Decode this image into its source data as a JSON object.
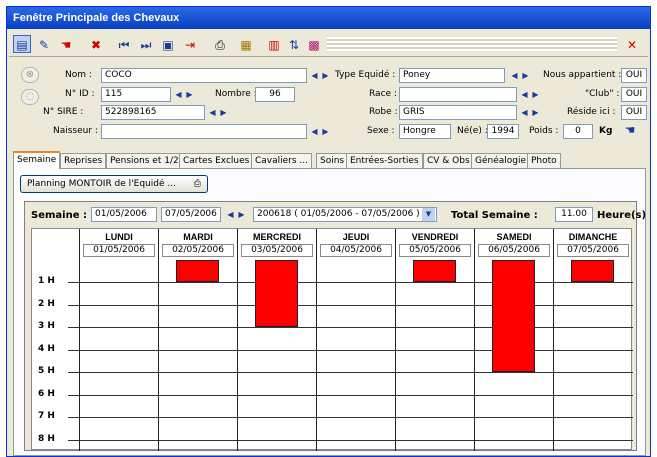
{
  "window": {
    "title": "Fenêtre Principale des Chevaux"
  },
  "toolbar": {
    "icons": [
      "new-record-icon",
      "edit-icon",
      "hand-icon",
      "delete-icon",
      "first-record-icon",
      "last-record-icon",
      "save-icon",
      "exit-icon",
      "print-icon",
      "table-icon",
      "bar-chart-icon",
      "sort-icon",
      "grid-icon",
      "close-icon"
    ]
  },
  "horse": {
    "nom_label": "Nom :",
    "nom": "COCO",
    "id_label": "N° ID :",
    "id": "115",
    "nombre_label": "Nombre :",
    "nombre": "96",
    "sire_label": "N° SIRE :",
    "sire": "522898165",
    "naisseur_label": "Naisseur :",
    "naisseur": "",
    "type_label": "Type Equidé :",
    "type": "Poney",
    "race_label": "Race :",
    "race": "",
    "robe_label": "Robe :",
    "robe": "GRIS",
    "sexe_label": "Sexe :",
    "sexe": "Hongre",
    "ne_label": "Né(e) :",
    "ne": "1994",
    "poids_label": "Poids :",
    "poids": "0",
    "kg": "Kg",
    "appartient_label": "Nous appartient :",
    "appartient": "OUI",
    "club_label": "\"Club\" :",
    "club": "OUI",
    "reside_label": "Réside ici :",
    "reside": "OUI"
  },
  "tabs": [
    "Semaine",
    "Reprises",
    "Pensions et 1/2",
    "Cartes Exclues",
    "Cavaliers ...",
    "Soins",
    "Entrées-Sorties",
    "CV & Obs",
    "Généalogie",
    "Photo"
  ],
  "planning": {
    "button_label": "Planning MONTOIR de l'Equidé ...",
    "semaine_label": "Semaine :",
    "date_from": "01/05/2006",
    "date_to": "07/05/2006",
    "week_select": "200618 ( 01/05/2006 - 07/05/2006 )",
    "total_label": "Total Semaine :",
    "total_value": "11.00",
    "unit": "Heure(s)"
  },
  "calendar": {
    "hours": [
      "1 H",
      "2 H",
      "3 H",
      "4 H",
      "5 H",
      "6 H",
      "7 H",
      "8 H"
    ],
    "days": [
      {
        "name": "LUNDI",
        "date": "01/05/2006",
        "hours": 0
      },
      {
        "name": "MARDI",
        "date": "02/05/2006",
        "hours": 1
      },
      {
        "name": "MERCREDI",
        "date": "03/05/2006",
        "hours": 3
      },
      {
        "name": "JEUDI",
        "date": "04/05/2006",
        "hours": 0
      },
      {
        "name": "VENDREDI",
        "date": "05/05/2006",
        "hours": 1
      },
      {
        "name": "SAMEDI",
        "date": "06/05/2006",
        "hours": 5
      },
      {
        "name": "DIMANCHE",
        "date": "07/05/2006",
        "hours": 1
      }
    ],
    "bar_color": "#ff0000"
  }
}
